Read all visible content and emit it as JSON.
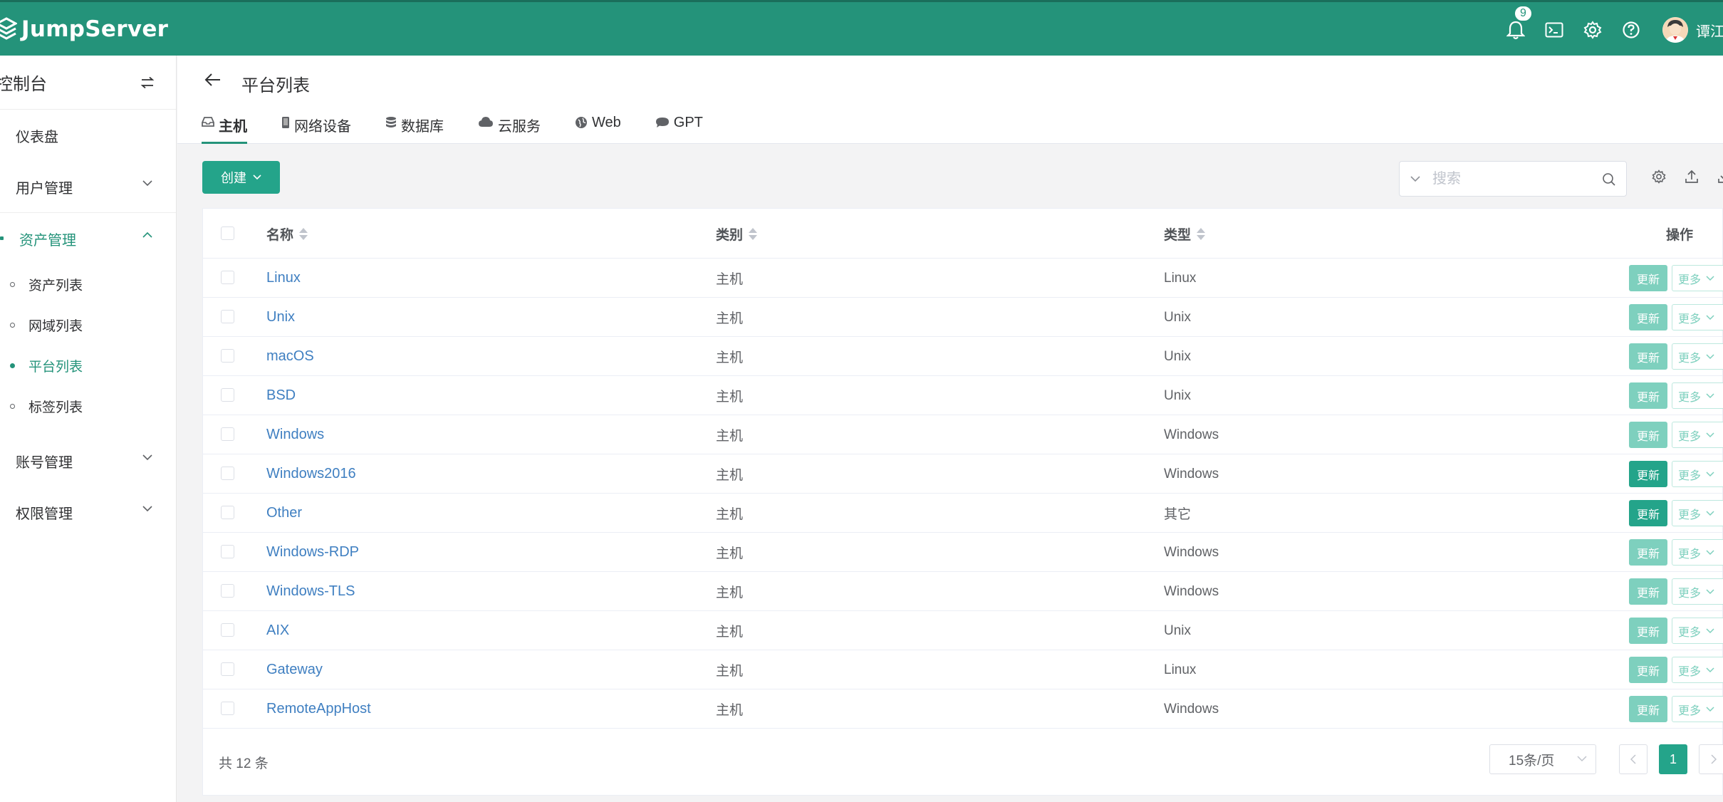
{
  "header": {
    "brand": "JumpServer",
    "notification_count": "9",
    "username": "谭江",
    "icons": [
      "bell-icon",
      "terminal-icon",
      "gear-icon",
      "help-icon"
    ]
  },
  "sidebar": {
    "title": "控制台",
    "items": [
      {
        "label": "仪表盘"
      },
      {
        "label": "用户管理"
      },
      {
        "label": "资产管理",
        "open": true,
        "children": [
          {
            "label": "资产列表"
          },
          {
            "label": "网域列表"
          },
          {
            "label": "平台列表",
            "active": true
          },
          {
            "label": "标签列表"
          }
        ]
      },
      {
        "label": "账号管理"
      },
      {
        "label": "权限管理"
      }
    ]
  },
  "page": {
    "title": "平台列表",
    "tabs": [
      {
        "label": "主机",
        "icon": "inbox-icon",
        "active": true
      },
      {
        "label": "网络设备",
        "icon": "device-icon"
      },
      {
        "label": "数据库",
        "icon": "database-icon"
      },
      {
        "label": "云服务",
        "icon": "cloud-icon"
      },
      {
        "label": "Web",
        "icon": "globe-icon"
      },
      {
        "label": "GPT",
        "icon": "chat-icon"
      }
    ]
  },
  "toolbar": {
    "create_label": "创建",
    "search_placeholder": "搜索"
  },
  "table": {
    "columns": {
      "name": "名称",
      "category": "类别",
      "type": "类型",
      "actions": "操作"
    },
    "update_label": "更新",
    "more_label": "更多",
    "rows": [
      {
        "name": "Linux",
        "category": "主机",
        "type": "Linux"
      },
      {
        "name": "Unix",
        "category": "主机",
        "type": "Unix"
      },
      {
        "name": "macOS",
        "category": "主机",
        "type": "Unix"
      },
      {
        "name": "BSD",
        "category": "主机",
        "type": "Unix"
      },
      {
        "name": "Windows",
        "category": "主机",
        "type": "Windows"
      },
      {
        "name": "Windows2016",
        "category": "主机",
        "type": "Windows"
      },
      {
        "name": "Other",
        "category": "主机",
        "type": "其它"
      },
      {
        "name": "Windows-RDP",
        "category": "主机",
        "type": "Windows"
      },
      {
        "name": "Windows-TLS",
        "category": "主机",
        "type": "Windows"
      },
      {
        "name": "AIX",
        "category": "主机",
        "type": "Unix"
      },
      {
        "name": "Gateway",
        "category": "主机",
        "type": "Linux"
      },
      {
        "name": "RemoteAppHost",
        "category": "主机",
        "type": "Windows"
      }
    ]
  },
  "pagination": {
    "total_text": "共 12 条",
    "page_size": "15条/页",
    "current_page": "1"
  },
  "colors": {
    "brand": "#24937a",
    "primary": "#24a48a",
    "link": "#3f7fc1"
  }
}
